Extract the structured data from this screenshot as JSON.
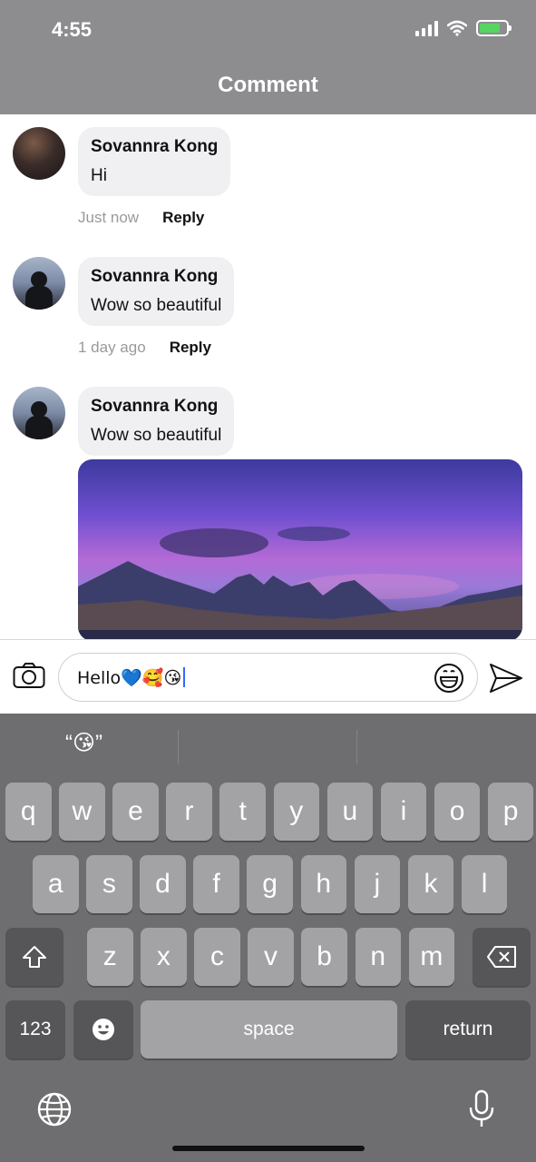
{
  "status": {
    "time": "4:55"
  },
  "header": {
    "title": "Comment"
  },
  "comments": [
    {
      "author": "Sovannra Kong",
      "text": "Hi",
      "time": "Just now",
      "reply_label": "Reply"
    },
    {
      "author": "Sovannra Kong",
      "text": "Wow so beautiful",
      "time": "1 day ago",
      "reply_label": "Reply"
    },
    {
      "author": "Sovannra Kong",
      "text": "Wow so beautiful"
    }
  ],
  "composer": {
    "value": "Hello💙🥰😘",
    "camera_icon": "camera-icon",
    "emoji_icon": "emoji-icon",
    "send_icon": "send-icon"
  },
  "keyboard": {
    "suggestion": "“😘”",
    "row1": [
      "q",
      "w",
      "e",
      "r",
      "t",
      "y",
      "u",
      "i",
      "o",
      "p"
    ],
    "row2": [
      "a",
      "s",
      "d",
      "f",
      "g",
      "h",
      "j",
      "k",
      "l"
    ],
    "row3": [
      "z",
      "x",
      "c",
      "v",
      "b",
      "n",
      "m"
    ],
    "numbers_label": "123",
    "space_label": "space",
    "return_label": "return"
  },
  "colors": {
    "battery": "#57d563",
    "caret": "#2f6bff"
  }
}
